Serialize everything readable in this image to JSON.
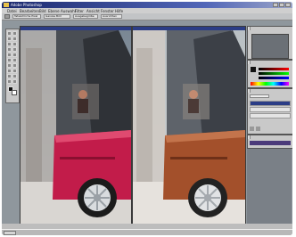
{
  "window": {
    "title": "Adobe Photoshop"
  },
  "menu": [
    {
      "label": "Datei"
    },
    {
      "label": "Bearbeiten"
    },
    {
      "label": "Bild"
    },
    {
      "label": "Ebene"
    },
    {
      "label": "Auswahl"
    },
    {
      "label": "Filter"
    },
    {
      "label": "Ansicht"
    },
    {
      "label": "Fenster"
    },
    {
      "label": "Hilfe"
    }
  ],
  "options_bar": {
    "buttons": [
      {
        "label": "Tatsächliche Pixel"
      },
      {
        "label": "Ganzes Bild"
      },
      {
        "label": "Ausgabegröße"
      },
      {
        "label": "Ausrichten"
      }
    ]
  },
  "colors": {
    "car_left": "#c21c4a",
    "car_right": "#a3502b",
    "titlebar": "#1d2a6e",
    "ui_gray": "#c9c9c9"
  }
}
